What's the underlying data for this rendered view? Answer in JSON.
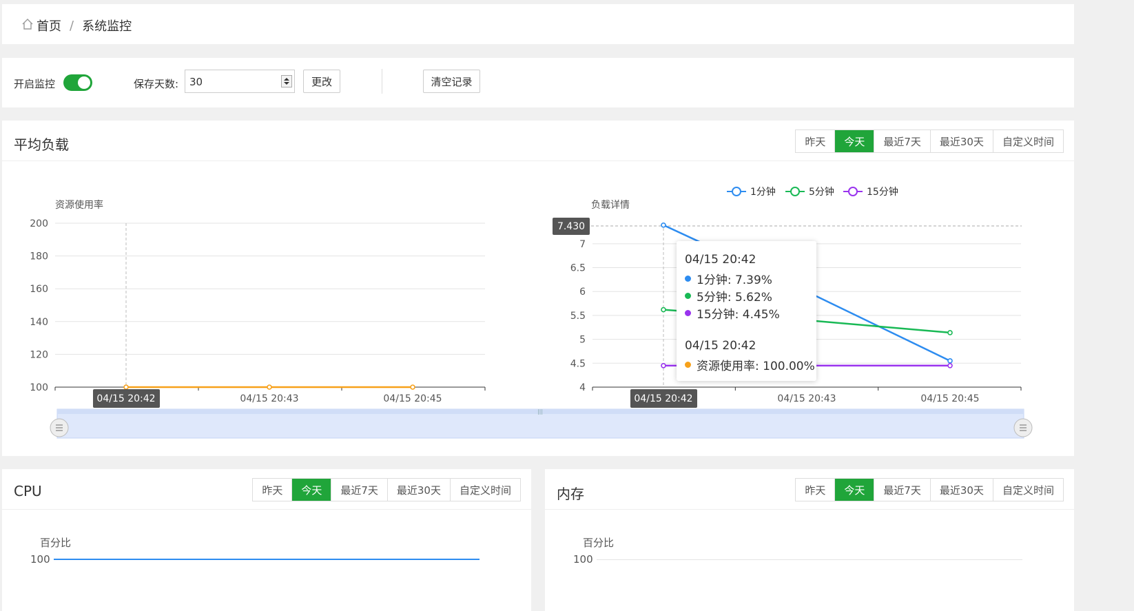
{
  "breadcrumb": {
    "home": "首页",
    "current": "系统监控"
  },
  "toolbar": {
    "monitor_label": "开启监控",
    "monitor_on": true,
    "days_label": "保存天数:",
    "days_value": "30",
    "change_label": "更改",
    "clear_label": "清空记录"
  },
  "range_options": [
    "昨天",
    "今天",
    "最近7天",
    "最近30天",
    "自定义时间"
  ],
  "range_active": 1,
  "load_panel": {
    "title": "平均负载"
  },
  "cpu_panel": {
    "title": "CPU",
    "y_axis_label": "百分比",
    "top_tick": "100"
  },
  "mem_panel": {
    "title": "内存",
    "y_axis_label": "百分比",
    "top_tick": "100"
  },
  "colors": {
    "accent": "#20a53a",
    "series_1m": "#2d8cf0",
    "series_5m": "#19b955",
    "series_15m": "#9933ee",
    "usage": "#f7a11a"
  },
  "chart_data": [
    {
      "type": "line",
      "ylabel": "资源使用率",
      "ylim": [
        100,
        200
      ],
      "yticks": [
        100,
        120,
        140,
        160,
        180,
        200
      ],
      "x": [
        "04/15 20:42",
        "04/15 20:43",
        "04/15 20:45"
      ],
      "series": [
        {
          "name": "资源使用率",
          "values": [
            100,
            100,
            100
          ]
        }
      ],
      "hover_label": "04/15 20:42"
    },
    {
      "type": "line",
      "ylabel": "负载详情",
      "ylim": [
        4,
        7.43
      ],
      "yticks": [
        4,
        4.5,
        5,
        5.5,
        6,
        6.5,
        7
      ],
      "x": [
        "04/15 20:42",
        "04/15 20:43",
        "04/15 20:45"
      ],
      "legend": [
        "1分钟",
        "5分钟",
        "15分钟"
      ],
      "series": [
        {
          "name": "1分钟",
          "values": [
            7.39,
            6.0,
            4.55
          ]
        },
        {
          "name": "5分钟",
          "values": [
            5.62,
            5.4,
            5.14
          ]
        },
        {
          "name": "15分钟",
          "values": [
            4.45,
            4.45,
            4.45
          ]
        }
      ],
      "pointer_value": "7.430",
      "hover_label": "04/15 20:42"
    },
    {
      "type": "line",
      "ylabel": "百分比",
      "series": [
        {
          "name": "CPU",
          "values": [
            100,
            100
          ]
        }
      ]
    }
  ],
  "tooltip": {
    "time1": "04/15 20:42",
    "row1": "1分钟: 7.39%",
    "row2": "5分钟: 5.62%",
    "row3": "15分钟: 4.45%",
    "time2": "04/15 20:42",
    "row4": "资源使用率: 100.00%"
  }
}
